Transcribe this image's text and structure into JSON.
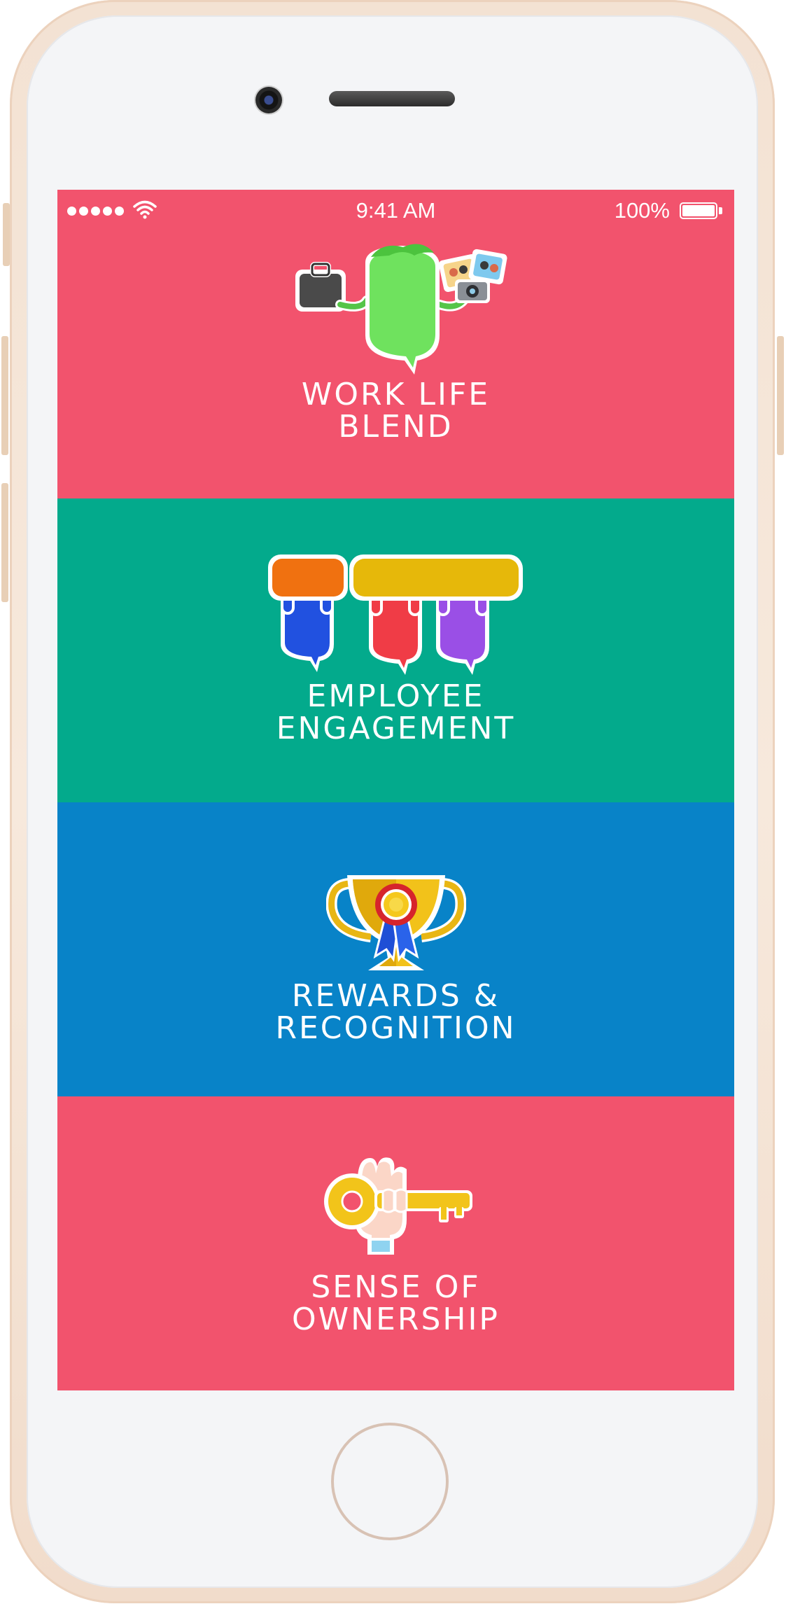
{
  "status_bar": {
    "time": "9:41 AM",
    "battery": "100%",
    "signal_icon": "signal-dots-icon",
    "wifi_icon": "wifi-icon"
  },
  "colors": {
    "pink": "#f2536d",
    "green": "#03aa8c",
    "blue": "#0883c8",
    "phone_frame": "#f3e2d3"
  },
  "tiles": [
    {
      "line1": "WORK LIFE",
      "line2": "BLEND",
      "icon": "work-life-blend-icon",
      "color": "#f2536d"
    },
    {
      "line1": "EMPLOYEE",
      "line2": "ENGAGEMENT",
      "icon": "team-holding-boards-icon",
      "color": "#03aa8c"
    },
    {
      "line1": "REWARDS &",
      "line2": "RECOGNITION",
      "icon": "trophy-icon",
      "color": "#0883c8"
    },
    {
      "line1": "SENSE OF",
      "line2": "OWNERSHIP",
      "icon": "hand-key-icon",
      "color": "#f2536d"
    }
  ]
}
